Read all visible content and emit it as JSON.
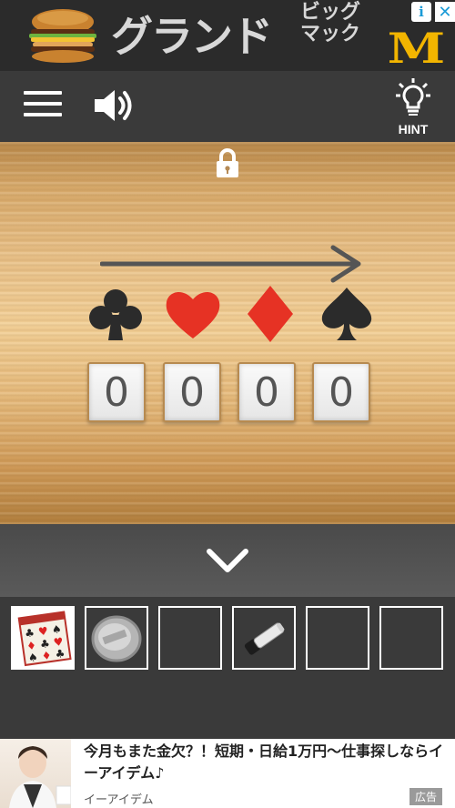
{
  "ad_top": {
    "headline": "グランド",
    "sub_line1": "ビッグ",
    "sub_line2": "マック",
    "brand_mark": "M",
    "info_symbol": "i",
    "close_symbol": "✕",
    "brand_color": "#f2b500"
  },
  "toolbar": {
    "menu_icon": "hamburger-menu-icon",
    "sound_icon": "speaker-icon",
    "hint_icon": "lightbulb-icon",
    "hint_label": "HINT"
  },
  "puzzle": {
    "lock_icon": "padlock-icon",
    "arrow_icon": "right-arrow-icon",
    "suits": [
      {
        "name": "club",
        "glyph": "♣",
        "color": "#2b2b2b"
      },
      {
        "name": "heart",
        "glyph": "♥",
        "color": "#e63224"
      },
      {
        "name": "diamond",
        "glyph": "♦",
        "color": "#e63224"
      },
      {
        "name": "spade",
        "glyph": "♠",
        "color": "#2b2b2b"
      }
    ],
    "code_digits": [
      "0",
      "0",
      "0",
      "0"
    ]
  },
  "navigation": {
    "down_icon": "chevron-down-icon"
  },
  "inventory": {
    "slots": [
      {
        "item": "suit-card-grid",
        "filled": true
      },
      {
        "item": "silver-coin",
        "filled": true
      },
      {
        "item": "",
        "filled": false
      },
      {
        "item": "flashlight",
        "filled": true
      },
      {
        "item": "",
        "filled": false
      },
      {
        "item": "",
        "filled": false
      }
    ]
  },
  "ad_bottom": {
    "headline": "今月もまた金欠？！短期・日給1万円〜仕事探しならイーアイデム♪",
    "advertiser": "イーアイデム",
    "tag": "広告"
  }
}
